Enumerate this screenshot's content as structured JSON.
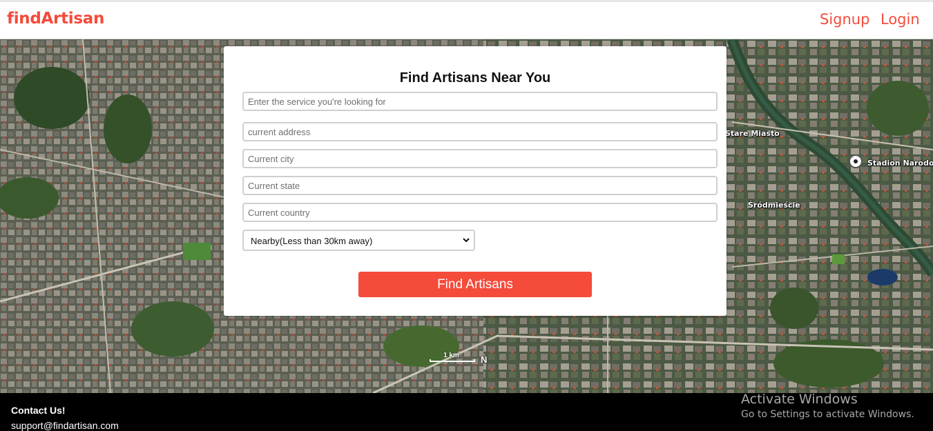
{
  "app": {
    "logo": "findArtisan"
  },
  "nav": {
    "signup": "Signup",
    "login": "Login"
  },
  "map": {
    "labels": {
      "stare_miasto": "Stare Miasto",
      "stadion": "Stadion Narodo",
      "srodmiescie": "Śródmieście"
    },
    "scale": "1 km",
    "compass": "N"
  },
  "form": {
    "title": "Find Artisans Near You",
    "service_placeholder": "Enter the service you're looking for",
    "address_placeholder": "current address",
    "city_placeholder": "Current city",
    "state_placeholder": "Current state",
    "country_placeholder": "Current country",
    "distance_selected": "Nearby(Less than 30km away)",
    "submit_label": "Find Artisans"
  },
  "footer": {
    "title": "Contact Us!",
    "email": "support@findartisan.com"
  },
  "watermark": {
    "title": "Activate Windows",
    "subtitle": "Go to Settings to activate Windows."
  },
  "colors": {
    "brand": "#f44b3b",
    "footer_bg": "#000000"
  }
}
